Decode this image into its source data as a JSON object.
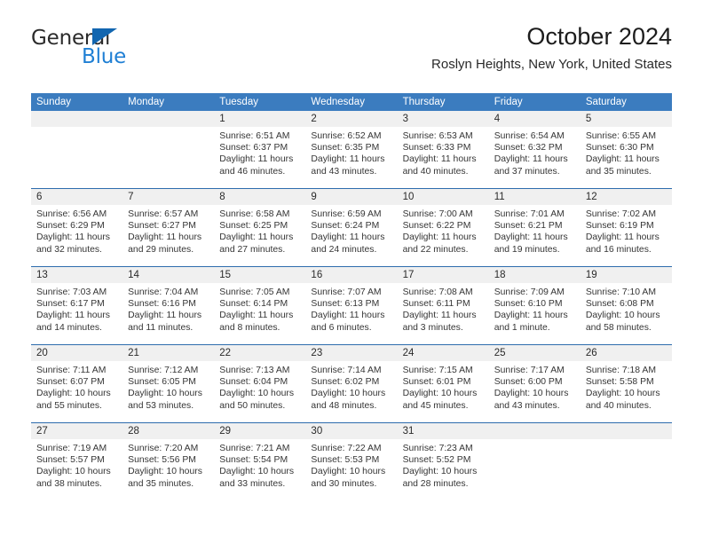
{
  "brand": {
    "word_one": "General",
    "word_two": "Blue",
    "triangle_icon": "triangle-icon",
    "color_dark": "#2b2b2b",
    "color_blue": "#1f7fd4"
  },
  "header": {
    "title": "October 2024",
    "subtitle": "Roslyn Heights, New York, United States"
  },
  "theme": {
    "header_blue": "#3b7cbf",
    "rule_blue": "#2d6cad",
    "daynum_bg": "#f0f0f0"
  },
  "calendar": {
    "weekdays": [
      "Sunday",
      "Monday",
      "Tuesday",
      "Wednesday",
      "Thursday",
      "Friday",
      "Saturday"
    ],
    "weeks": [
      [
        {
          "day": "",
          "lines": []
        },
        {
          "day": "",
          "lines": []
        },
        {
          "day": "1",
          "lines": [
            "Sunrise: 6:51 AM",
            "Sunset: 6:37 PM",
            "Daylight: 11 hours",
            "and 46 minutes."
          ]
        },
        {
          "day": "2",
          "lines": [
            "Sunrise: 6:52 AM",
            "Sunset: 6:35 PM",
            "Daylight: 11 hours",
            "and 43 minutes."
          ]
        },
        {
          "day": "3",
          "lines": [
            "Sunrise: 6:53 AM",
            "Sunset: 6:33 PM",
            "Daylight: 11 hours",
            "and 40 minutes."
          ]
        },
        {
          "day": "4",
          "lines": [
            "Sunrise: 6:54 AM",
            "Sunset: 6:32 PM",
            "Daylight: 11 hours",
            "and 37 minutes."
          ]
        },
        {
          "day": "5",
          "lines": [
            "Sunrise: 6:55 AM",
            "Sunset: 6:30 PM",
            "Daylight: 11 hours",
            "and 35 minutes."
          ]
        }
      ],
      [
        {
          "day": "6",
          "lines": [
            "Sunrise: 6:56 AM",
            "Sunset: 6:29 PM",
            "Daylight: 11 hours",
            "and 32 minutes."
          ]
        },
        {
          "day": "7",
          "lines": [
            "Sunrise: 6:57 AM",
            "Sunset: 6:27 PM",
            "Daylight: 11 hours",
            "and 29 minutes."
          ]
        },
        {
          "day": "8",
          "lines": [
            "Sunrise: 6:58 AM",
            "Sunset: 6:25 PM",
            "Daylight: 11 hours",
            "and 27 minutes."
          ]
        },
        {
          "day": "9",
          "lines": [
            "Sunrise: 6:59 AM",
            "Sunset: 6:24 PM",
            "Daylight: 11 hours",
            "and 24 minutes."
          ]
        },
        {
          "day": "10",
          "lines": [
            "Sunrise: 7:00 AM",
            "Sunset: 6:22 PM",
            "Daylight: 11 hours",
            "and 22 minutes."
          ]
        },
        {
          "day": "11",
          "lines": [
            "Sunrise: 7:01 AM",
            "Sunset: 6:21 PM",
            "Daylight: 11 hours",
            "and 19 minutes."
          ]
        },
        {
          "day": "12",
          "lines": [
            "Sunrise: 7:02 AM",
            "Sunset: 6:19 PM",
            "Daylight: 11 hours",
            "and 16 minutes."
          ]
        }
      ],
      [
        {
          "day": "13",
          "lines": [
            "Sunrise: 7:03 AM",
            "Sunset: 6:17 PM",
            "Daylight: 11 hours",
            "and 14 minutes."
          ]
        },
        {
          "day": "14",
          "lines": [
            "Sunrise: 7:04 AM",
            "Sunset: 6:16 PM",
            "Daylight: 11 hours",
            "and 11 minutes."
          ]
        },
        {
          "day": "15",
          "lines": [
            "Sunrise: 7:05 AM",
            "Sunset: 6:14 PM",
            "Daylight: 11 hours",
            "and 8 minutes."
          ]
        },
        {
          "day": "16",
          "lines": [
            "Sunrise: 7:07 AM",
            "Sunset: 6:13 PM",
            "Daylight: 11 hours",
            "and 6 minutes."
          ]
        },
        {
          "day": "17",
          "lines": [
            "Sunrise: 7:08 AM",
            "Sunset: 6:11 PM",
            "Daylight: 11 hours",
            "and 3 minutes."
          ]
        },
        {
          "day": "18",
          "lines": [
            "Sunrise: 7:09 AM",
            "Sunset: 6:10 PM",
            "Daylight: 11 hours",
            "and 1 minute."
          ]
        },
        {
          "day": "19",
          "lines": [
            "Sunrise: 7:10 AM",
            "Sunset: 6:08 PM",
            "Daylight: 10 hours",
            "and 58 minutes."
          ]
        }
      ],
      [
        {
          "day": "20",
          "lines": [
            "Sunrise: 7:11 AM",
            "Sunset: 6:07 PM",
            "Daylight: 10 hours",
            "and 55 minutes."
          ]
        },
        {
          "day": "21",
          "lines": [
            "Sunrise: 7:12 AM",
            "Sunset: 6:05 PM",
            "Daylight: 10 hours",
            "and 53 minutes."
          ]
        },
        {
          "day": "22",
          "lines": [
            "Sunrise: 7:13 AM",
            "Sunset: 6:04 PM",
            "Daylight: 10 hours",
            "and 50 minutes."
          ]
        },
        {
          "day": "23",
          "lines": [
            "Sunrise: 7:14 AM",
            "Sunset: 6:02 PM",
            "Daylight: 10 hours",
            "and 48 minutes."
          ]
        },
        {
          "day": "24",
          "lines": [
            "Sunrise: 7:15 AM",
            "Sunset: 6:01 PM",
            "Daylight: 10 hours",
            "and 45 minutes."
          ]
        },
        {
          "day": "25",
          "lines": [
            "Sunrise: 7:17 AM",
            "Sunset: 6:00 PM",
            "Daylight: 10 hours",
            "and 43 minutes."
          ]
        },
        {
          "day": "26",
          "lines": [
            "Sunrise: 7:18 AM",
            "Sunset: 5:58 PM",
            "Daylight: 10 hours",
            "and 40 minutes."
          ]
        }
      ],
      [
        {
          "day": "27",
          "lines": [
            "Sunrise: 7:19 AM",
            "Sunset: 5:57 PM",
            "Daylight: 10 hours",
            "and 38 minutes."
          ]
        },
        {
          "day": "28",
          "lines": [
            "Sunrise: 7:20 AM",
            "Sunset: 5:56 PM",
            "Daylight: 10 hours",
            "and 35 minutes."
          ]
        },
        {
          "day": "29",
          "lines": [
            "Sunrise: 7:21 AM",
            "Sunset: 5:54 PM",
            "Daylight: 10 hours",
            "and 33 minutes."
          ]
        },
        {
          "day": "30",
          "lines": [
            "Sunrise: 7:22 AM",
            "Sunset: 5:53 PM",
            "Daylight: 10 hours",
            "and 30 minutes."
          ]
        },
        {
          "day": "31",
          "lines": [
            "Sunrise: 7:23 AM",
            "Sunset: 5:52 PM",
            "Daylight: 10 hours",
            "and 28 minutes."
          ]
        },
        {
          "day": "",
          "lines": []
        },
        {
          "day": "",
          "lines": []
        }
      ]
    ]
  }
}
